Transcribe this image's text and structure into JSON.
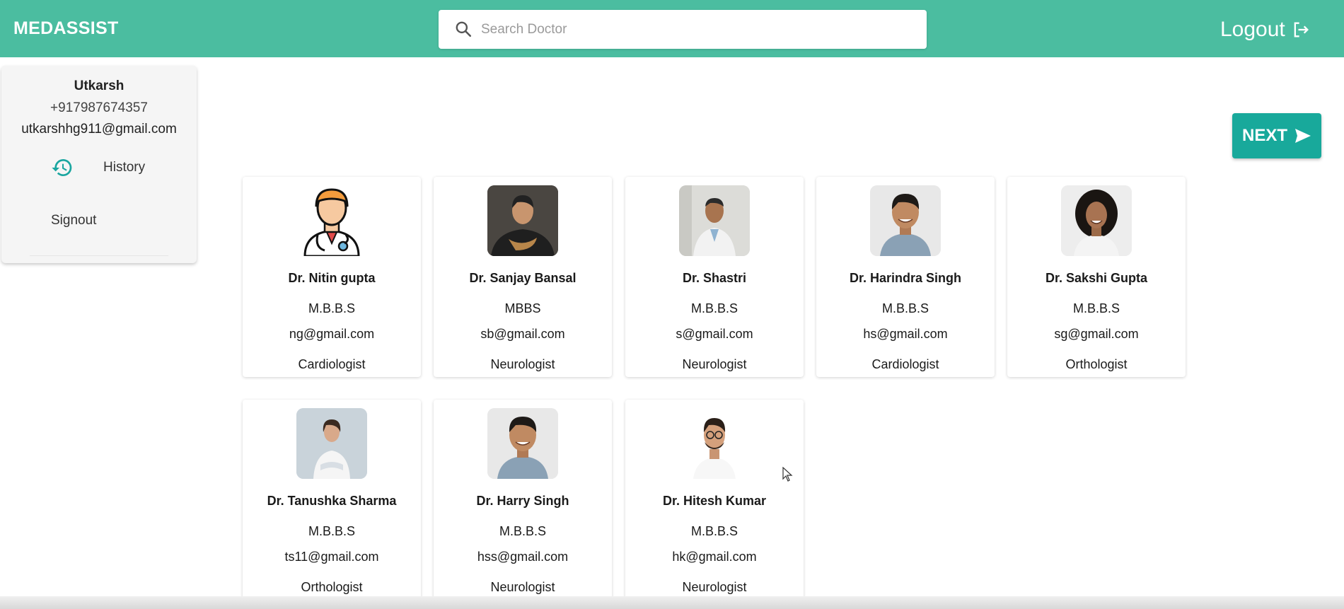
{
  "header": {
    "brand": "MEDASSIST",
    "search_placeholder": "Search Doctor",
    "logout_label": "Logout",
    "accent_color": "#4bbda0"
  },
  "profile": {
    "name": "Utkarsh",
    "phone": "+917987674357",
    "email": "utkarshhg911@gmail.com",
    "history_label": "History",
    "signout_label": "Signout"
  },
  "next_button": {
    "label": "NEXT",
    "color": "#18a99b"
  },
  "doctors": [
    {
      "name": "Dr. Nitin gupta",
      "degree": "M.B.B.S",
      "email": "ng@gmail.com",
      "specialty": "Cardiologist"
    },
    {
      "name": "Dr. Sanjay Bansal",
      "degree": "MBBS",
      "email": "sb@gmail.com",
      "specialty": "Neurologist"
    },
    {
      "name": "Dr. Shastri",
      "degree": "M.B.B.S",
      "email": "s@gmail.com",
      "specialty": "Neurologist"
    },
    {
      "name": "Dr. Harindra Singh",
      "degree": "M.B.B.S",
      "email": "hs@gmail.com",
      "specialty": "Cardiologist"
    },
    {
      "name": "Dr. Sakshi Gupta",
      "degree": "M.B.B.S",
      "email": "sg@gmail.com",
      "specialty": "Orthologist"
    },
    {
      "name": "Dr. Tanushka Sharma",
      "degree": "M.B.B.S",
      "email": "ts11@gmail.com",
      "specialty": "Orthologist"
    },
    {
      "name": "Dr. Harry Singh",
      "degree": "M.B.B.S",
      "email": "hss@gmail.com",
      "specialty": "Neurologist"
    },
    {
      "name": "Dr. Hitesh Kumar",
      "degree": "M.B.B.S",
      "email": "hk@gmail.com",
      "specialty": "Neurologist"
    }
  ]
}
